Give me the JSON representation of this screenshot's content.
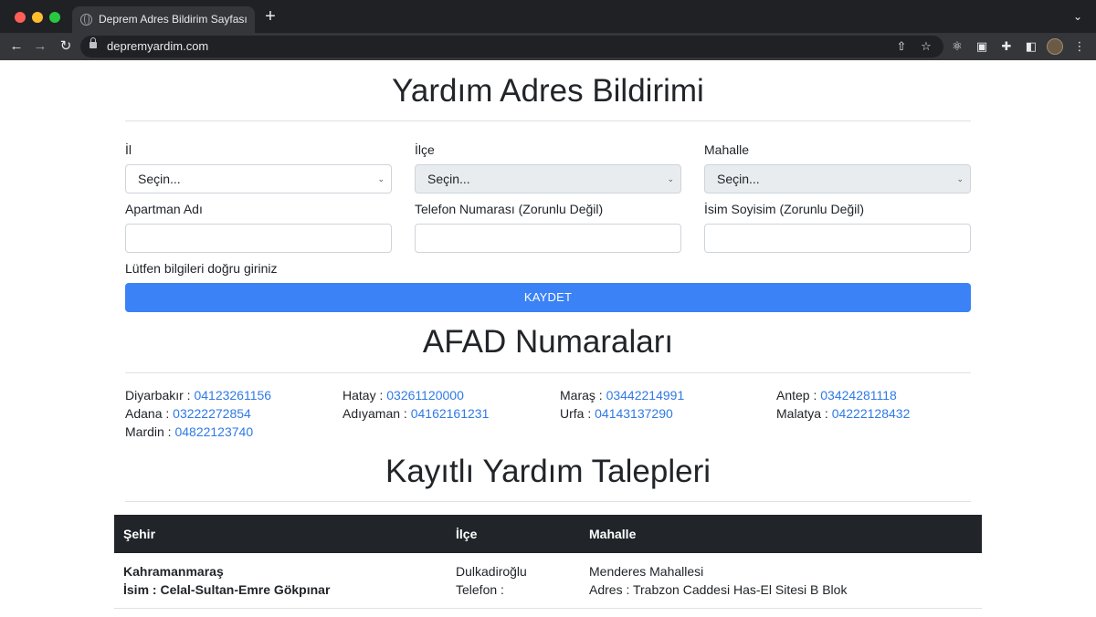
{
  "browser": {
    "tab_title": "Deprem Adres Bildirim Sayfası",
    "url": "depremyardim.com"
  },
  "form": {
    "title": "Yardım Adres Bildirimi",
    "il_label": "İl",
    "ilce_label": "İlçe",
    "mahalle_label": "Mahalle",
    "il_value": "Seçin...",
    "ilce_value": "Seçin...",
    "mahalle_value": "Seçin...",
    "apartman_label": "Apartman Adı",
    "telefon_label": "Telefon Numarası (Zorunlu Değil)",
    "isim_label": "İsim Soyisim (Zorunlu Değil)",
    "hint": "Lütfen bilgileri doğru giriniz",
    "submit_label": "KAYDET"
  },
  "afad": {
    "title": "AFAD Numaraları",
    "numbers": [
      {
        "city": "Diyarbakır :",
        "number": "04123261156"
      },
      {
        "city": "Hatay :",
        "number": "03261120000"
      },
      {
        "city": "Maraş :",
        "number": "03442214991"
      },
      {
        "city": "Antep :",
        "number": "03424281118"
      },
      {
        "city": "Adana :",
        "number": "03222272854"
      },
      {
        "city": "Adıyaman :",
        "number": "04162161231"
      },
      {
        "city": "Urfa :",
        "number": "04143137290"
      },
      {
        "city": "Malatya :",
        "number": "04222128432"
      },
      {
        "city": "Mardin :",
        "number": "04822123740"
      }
    ]
  },
  "requests": {
    "title": "Kayıtlı Yardım Talepleri",
    "columns": [
      "Şehir",
      "İlçe",
      "Mahalle"
    ],
    "rows": [
      {
        "sehir": "Kahramanmaraş",
        "isim": "İsim : Celal-Sultan-Emre Gökpınar",
        "ilce": "Dulkadiroğlu",
        "telefon": "Telefon :",
        "mahalle": "Menderes Mahallesi",
        "adres": "Adres : Trabzon Caddesi Has-El Sitesi B Blok"
      }
    ]
  }
}
